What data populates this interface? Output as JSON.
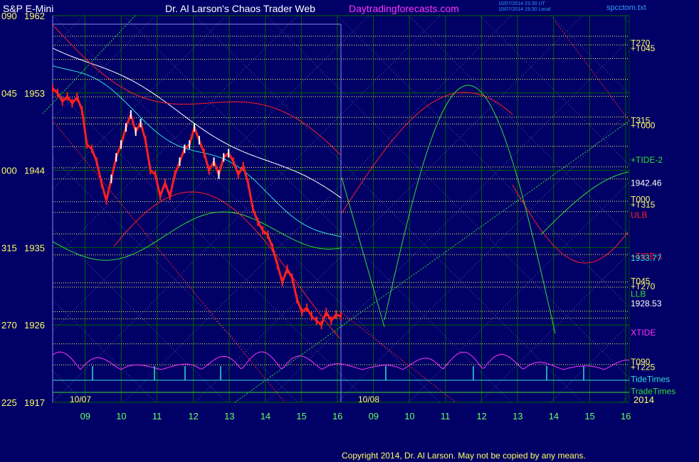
{
  "header": {
    "symbol": "S&P E-Mini",
    "title": "Dr. Al Larson's Chaos Trader Web",
    "site": "Daytradingforecasts.com",
    "timestamp_line1": "10/07/2014 23:30 UT",
    "timestamp_line2": "10/07/2014 19:30 Local",
    "file": "spcctom.txt"
  },
  "footer": {
    "copyright": "Copyright 2014, Dr. Al Larson. May not be copied by any means."
  },
  "colors": {
    "background": "#000066",
    "grid_green": "#006400",
    "yellow": "#ffff66",
    "red": "#ff2020",
    "green": "#33dd33",
    "cyan": "#33dddd",
    "magenta": "#ff33ff",
    "white": "#ffffff"
  },
  "chart_data": {
    "type": "line",
    "title": "S&P E-Mini",
    "ylim": [
      1917,
      1962
    ],
    "price_ticks": [
      {
        "price": 1962,
        "angle": "090",
        "label": "1962"
      },
      {
        "price": 1953,
        "angle": "045",
        "label": "1953"
      },
      {
        "price": 1944,
        "angle": "000",
        "label": "1944"
      },
      {
        "price": 1935,
        "angle": "315",
        "label": "1935"
      },
      {
        "price": 1926,
        "angle": "270",
        "label": "1926"
      },
      {
        "price": 1917,
        "angle": "225",
        "label": "1917"
      }
    ],
    "days": [
      {
        "label": "10/07",
        "hours": [
          "09",
          "10",
          "11",
          "12",
          "13",
          "14",
          "15",
          "16"
        ]
      },
      {
        "label": "10/08",
        "hours": [
          "09",
          "10",
          "11",
          "12",
          "13",
          "14",
          "15",
          "16"
        ]
      }
    ],
    "year_label": "2014",
    "right_labels": [
      {
        "text": "T270",
        "price": 1958.8,
        "color": "yellow"
      },
      {
        "text": "+T045",
        "price": 1958.2,
        "color": "yellow"
      },
      {
        "text": "T315",
        "price": 1949.8,
        "color": "yellow"
      },
      {
        "text": "+T000",
        "price": 1949.2,
        "color": "yellow"
      },
      {
        "text": "+TIDE-2",
        "price": 1945.2,
        "color": "green"
      },
      {
        "text": "1942.46",
        "price": 1942.5,
        "color": "white"
      },
      {
        "text": "T000",
        "price": 1940.6,
        "color": "yellow"
      },
      {
        "text": "+T315",
        "price": 1940.0,
        "color": "yellow"
      },
      {
        "text": "ULB",
        "price": 1938.8,
        "color": "red"
      },
      {
        "text": "+TIDE-1",
        "price": 1934.0,
        "color": "red"
      },
      {
        "text": "1933.77",
        "price": 1933.8,
        "color": "cyan"
      },
      {
        "text": "T045",
        "price": 1931.1,
        "color": "yellow"
      },
      {
        "text": "+T270",
        "price": 1930.5,
        "color": "yellow"
      },
      {
        "text": "LLB",
        "price": 1929.6,
        "color": "green"
      },
      {
        "text": "1928.53",
        "price": 1928.5,
        "color": "white"
      },
      {
        "text": "XTIDE",
        "price": 1925.1,
        "color": "magenta"
      },
      {
        "text": "T090",
        "price": 1921.7,
        "color": "yellow"
      },
      {
        "text": "+T225",
        "price": 1921.1,
        "color": "yellow"
      },
      {
        "text": "TideTimes",
        "price": 1919.7,
        "color": "cyan"
      },
      {
        "text": "TradeTimes",
        "price": 1918.3,
        "color": "green"
      }
    ],
    "levels_yellow": [
      1959.6,
      1958.6,
      1957.0,
      1954.6,
      1952.6,
      1950.2,
      1949.4,
      1946.8,
      1944.4,
      1943.0,
      1940.4,
      1939.2,
      1936.6,
      1934.2,
      1931.0,
      1930.4,
      1927.6,
      1926.8,
      1923.8,
      1921.4
    ],
    "series": [
      {
        "name": "Price",
        "color": "red",
        "x": [
          0,
          0.1,
          0.2,
          0.3,
          0.4,
          0.5,
          0.6,
          0.7,
          0.8,
          0.9,
          1.0,
          1.1,
          1.2,
          1.3,
          1.4,
          1.5,
          1.6,
          1.7,
          1.8,
          1.9,
          2.0,
          2.1,
          2.2,
          2.3,
          2.4,
          2.5,
          2.6,
          2.7,
          2.8,
          2.9,
          3.0,
          3.1,
          3.2,
          3.3,
          3.4,
          3.5,
          3.6,
          3.7,
          3.8,
          3.9,
          4.0,
          4.1,
          4.2,
          4.3,
          4.4,
          4.5,
          4.6,
          4.7,
          4.8,
          4.9,
          5.0,
          5.1,
          5.2,
          5.3,
          5.4,
          5.5,
          5.6,
          5.7,
          5.8,
          5.9,
          6.0,
          6.1,
          6.2,
          6.3,
          6.4,
          6.5,
          6.6,
          6.7,
          6.8,
          6.9,
          7.0,
          7.1,
          7.2,
          7.3,
          7.4,
          7.5,
          7.6,
          7.7
        ],
        "values": [
          1953.5,
          1953.0,
          1952.0,
          1952.6,
          1951.8,
          1952.5,
          1951.0,
          1947.0,
          1946.5,
          1945.0,
          1942.5,
          1940.5,
          1943.0,
          1945.5,
          1947.0,
          1949.0,
          1950.5,
          1948.5,
          1949.5,
          1947.5,
          1944.0,
          1943.5,
          1941.0,
          1942.5,
          1941.0,
          1943.5,
          1945.0,
          1946.5,
          1947.0,
          1949.0,
          1947.5,
          1946.0,
          1944.0,
          1945.0,
          1943.5,
          1945.5,
          1946.0,
          1945.0,
          1943.5,
          1944.5,
          1942.5,
          1939.5,
          1938.0,
          1937.0,
          1936.5,
          1935.0,
          1933.0,
          1931.0,
          1932.5,
          1931.5,
          1929.0,
          1927.5,
          1928.0,
          1927.0,
          1926.5,
          1926.0,
          1927.5,
          1926.5,
          1927.2,
          1927.0,
          1927.0,
          1927.0,
          1927.0,
          1927.0,
          1927.0,
          1927.0,
          1927.0,
          1927.0,
          1927.0,
          1927.0,
          1927.0,
          1927.0,
          1927.0,
          1927.0,
          1927.0,
          1927.0,
          1927.0,
          1927.0
        ]
      }
    ],
    "price_x_end": 7.7
  }
}
